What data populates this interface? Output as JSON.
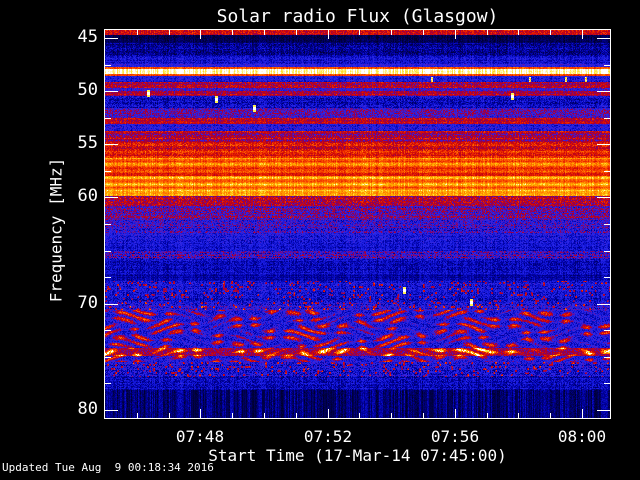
{
  "title": "Solar radio Flux (Glasgow)",
  "footer": {
    "updated": "Updated Tue Aug  9 00:18:34 2016"
  },
  "chart_data": {
    "type": "heatmap",
    "title": "Solar radio Flux (Glasgow)",
    "xlabel": "Start Time (17-Mar-14 07:45:00)",
    "ylabel": "Frequency [MHz]",
    "station": "Glasgow",
    "date": "17-Mar-14",
    "start_time": "07:45:00",
    "end_time": "08:00",
    "freq_range": [
      44.25,
      80.75
    ],
    "time_range_min": [
      0,
      15.88
    ],
    "y_axis": {
      "ticks": [
        {
          "f": 45,
          "label": "45"
        },
        {
          "f": 50,
          "label": "50"
        },
        {
          "f": 55,
          "label": "55"
        },
        {
          "f": 60,
          "label": "60"
        },
        {
          "f": 70,
          "label": "70"
        },
        {
          "f": 80,
          "label": "80"
        }
      ],
      "minor_ticks": [
        47.5,
        52.5,
        57.5,
        62.5,
        65,
        67.5,
        72.5,
        75,
        77.5
      ],
      "inverted": true
    },
    "x_axis": {
      "ticks": [
        {
          "t": 3,
          "label": "07:48"
        },
        {
          "t": 7,
          "label": "07:52"
        },
        {
          "t": 11,
          "label": "07:56"
        },
        {
          "t": 15,
          "label": "08:00"
        }
      ],
      "minor_ticks": [
        1,
        2,
        4,
        5,
        6,
        8,
        9,
        10,
        12,
        13,
        14
      ]
    },
    "palette": [
      [
        0.0,
        "#000028"
      ],
      [
        0.08,
        "#00005a"
      ],
      [
        0.18,
        "#0000a0"
      ],
      [
        0.28,
        "#1418dc"
      ],
      [
        0.36,
        "#2d28e6"
      ],
      [
        0.44,
        "#5514b4"
      ],
      [
        0.52,
        "#8c005a"
      ],
      [
        0.6,
        "#b9001e"
      ],
      [
        0.68,
        "#dc1400"
      ],
      [
        0.76,
        "#f53c00"
      ],
      [
        0.84,
        "#ff7800"
      ],
      [
        0.9,
        "#ffaf00"
      ],
      [
        0.95,
        "#ffe63c"
      ],
      [
        1.0,
        "#ffffff"
      ]
    ],
    "bands": [
      {
        "f0": 44.25,
        "f1": 44.75,
        "v": 0.66,
        "n": 0.1
      },
      {
        "f0": 44.75,
        "f1": 45.5,
        "v": 0.07,
        "n": 0.05
      },
      {
        "f0": 45.5,
        "f1": 46.7,
        "v": 0.17,
        "n": 0.09
      },
      {
        "f0": 46.7,
        "f1": 47.45,
        "v": 0.26,
        "n": 0.08
      },
      {
        "f0": 47.45,
        "f1": 47.75,
        "v": 0.35,
        "n": 0.07
      },
      {
        "f0": 47.75,
        "f1": 47.95,
        "v": 0.78,
        "n": 0.06
      },
      {
        "f0": 47.95,
        "f1": 48.4,
        "v": 0.985,
        "n": 0.015
      },
      {
        "f0": 48.4,
        "f1": 48.6,
        "v": 0.76,
        "n": 0.06
      },
      {
        "f0": 48.6,
        "f1": 49.15,
        "v": 0.3,
        "n": 0.09,
        "fx": "rfi"
      },
      {
        "f0": 49.15,
        "f1": 49.7,
        "v": 0.58,
        "n": 0.12
      },
      {
        "f0": 49.7,
        "f1": 50.0,
        "v": 0.36,
        "n": 0.12
      },
      {
        "f0": 50.0,
        "f1": 50.45,
        "v": 0.58,
        "n": 0.1
      },
      {
        "f0": 50.45,
        "f1": 51.6,
        "v": 0.24,
        "n": 0.1
      },
      {
        "f0": 51.6,
        "f1": 52.55,
        "v": 0.42,
        "n": 0.14
      },
      {
        "f0": 52.55,
        "f1": 53.1,
        "v": 0.6,
        "n": 0.1
      },
      {
        "f0": 53.1,
        "f1": 53.75,
        "v": 0.32,
        "n": 0.1
      },
      {
        "f0": 53.75,
        "f1": 54.7,
        "v": 0.55,
        "n": 0.12,
        "fx": "alt"
      },
      {
        "f0": 54.7,
        "f1": 55.65,
        "v": 0.65,
        "n": 0.1,
        "fx": "alt"
      },
      {
        "f0": 55.65,
        "f1": 56.3,
        "v": 0.71,
        "n": 0.08,
        "fx": "alt"
      },
      {
        "f0": 56.3,
        "f1": 57.25,
        "v": 0.82,
        "n": 0.05,
        "fx": "alt"
      },
      {
        "f0": 57.25,
        "f1": 58.0,
        "v": 0.74,
        "n": 0.06,
        "fx": "alt"
      },
      {
        "f0": 58.0,
        "f1": 59.4,
        "v": 0.85,
        "n": 0.04,
        "fx": "alt"
      },
      {
        "f0": 59.4,
        "f1": 59.9,
        "v": 0.88,
        "n": 0.04
      },
      {
        "f0": 59.9,
        "f1": 60.8,
        "v": 0.58,
        "n": 0.13
      },
      {
        "f0": 60.8,
        "f1": 62.05,
        "v": 0.45,
        "n": 0.16
      },
      {
        "f0": 62.05,
        "f1": 63.35,
        "v": 0.37,
        "n": 0.15
      },
      {
        "f0": 63.35,
        "f1": 64.3,
        "v": 0.3,
        "n": 0.1
      },
      {
        "f0": 64.3,
        "f1": 65.05,
        "v": 0.27,
        "n": 0.08
      },
      {
        "f0": 65.05,
        "f1": 65.8,
        "v": 0.38,
        "n": 0.17
      },
      {
        "f0": 65.8,
        "f1": 67.2,
        "v": 0.23,
        "n": 0.08
      },
      {
        "f0": 67.2,
        "f1": 67.9,
        "v": 0.19,
        "n": 0.06
      },
      {
        "f0": 67.9,
        "f1": 69.95,
        "v": 0.27,
        "n": 0.1,
        "fx": "vspeckle"
      },
      {
        "f0": 69.95,
        "f1": 70.6,
        "v": 0.33,
        "n": 0.14,
        "fx": "vspeckle"
      },
      {
        "f0": 70.6,
        "f1": 75.5,
        "v": 0.33,
        "n": 0.12,
        "fx": "burst"
      },
      {
        "f0": 75.5,
        "f1": 76.9,
        "v": 0.29,
        "n": 0.13,
        "fx": "vspeckle"
      },
      {
        "f0": 76.9,
        "f1": 78.1,
        "v": 0.22,
        "n": 0.09
      },
      {
        "f0": 78.1,
        "f1": 80.75,
        "v": 0.15,
        "n": 0.07,
        "fx": "darkcols"
      }
    ],
    "features": {
      "bright_channel_mhz": [
        47.95,
        48.4
      ],
      "burst_bright_row": {
        "f0": 74.2,
        "f1": 74.95
      },
      "rfi_dense_time_min": [
        10.0,
        15.4
      ],
      "rfi_spots": [
        {
          "t": 1.32,
          "f": 50.2
        },
        {
          "t": 3.46,
          "f": 50.7
        },
        {
          "t": 4.66,
          "f": 51.6
        },
        {
          "t": 12.77,
          "f": 50.5
        },
        {
          "t": 9.37,
          "f": 68.7
        },
        {
          "t": 11.48,
          "f": 69.8
        }
      ]
    }
  }
}
